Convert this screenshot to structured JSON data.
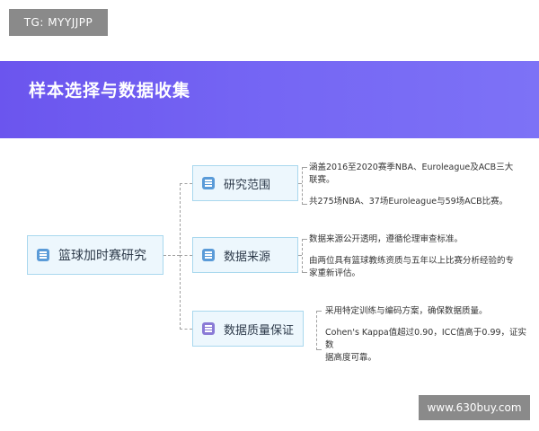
{
  "watermark_top": "TG: MYYJJPP",
  "page_title": "样本选择与数据收集",
  "root": {
    "label": "篮球加时赛研究",
    "icon": "basketball-data-icon"
  },
  "branches": [
    {
      "label": "研究范围",
      "icon": "document-icon",
      "items": [
        {
          "line1": "涵盖2016至2020赛季NBA、Euroleague及ACB三大",
          "line2": "联赛。"
        },
        {
          "line1": "共275场NBA、37场Euroleague与59场ACB比赛。"
        }
      ]
    },
    {
      "label": "数据来源",
      "icon": "user-data-icon",
      "items": [
        {
          "line1": "数据来源公开透明，遵循伦理审查标准。"
        },
        {
          "line1": "由两位具有篮球教练资质与五年以上比赛分析经验的专",
          "line2": "家重新评估。"
        }
      ]
    },
    {
      "label": "数据质量保证",
      "icon": "inbox-icon",
      "items": [
        {
          "line1": "采用特定训练与编码方案，确保数据质量。"
        },
        {
          "line1": "Cohen's Kappa值超过0.90，ICC值高于0.99，证实数",
          "line2": "据高度可靠。"
        }
      ]
    }
  ],
  "watermark_bottom": "www.630buy.com"
}
